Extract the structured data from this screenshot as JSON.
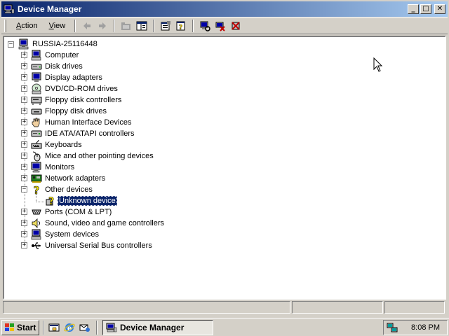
{
  "window": {
    "title": "Device Manager",
    "caption_buttons": {
      "minimize": "_",
      "maximize": "□",
      "close": "✕"
    }
  },
  "toolbar": {
    "menus": [
      {
        "label_accel": "A",
        "label_rest": "ction"
      },
      {
        "label_accel": "V",
        "label_rest": "iew"
      }
    ],
    "buttons": [
      "back-icon",
      "forward-icon",
      "up-folder-icon",
      "show-hide-tree-icon",
      "properties-icon",
      "help-icon",
      "scan-hardware-icon",
      "disable-device-icon",
      "uninstall-device-icon"
    ]
  },
  "tree": {
    "root": {
      "label": "RUSSIA-25116448",
      "icon": "computer-icon"
    },
    "items": [
      {
        "label": "Computer",
        "icon": "computer-icon",
        "expanded": false
      },
      {
        "label": "Disk drives",
        "icon": "disk-drive-icon",
        "expanded": false
      },
      {
        "label": "Display adapters",
        "icon": "display-adapter-icon",
        "expanded": false
      },
      {
        "label": "DVD/CD-ROM drives",
        "icon": "cdrom-icon",
        "expanded": false
      },
      {
        "label": "Floppy disk controllers",
        "icon": "floppy-controller-icon",
        "expanded": false
      },
      {
        "label": "Floppy disk drives",
        "icon": "floppy-drive-icon",
        "expanded": false
      },
      {
        "label": "Human Interface Devices",
        "icon": "hid-icon",
        "expanded": false
      },
      {
        "label": "IDE ATA/ATAPI controllers",
        "icon": "ide-controller-icon",
        "expanded": false
      },
      {
        "label": "Keyboards",
        "icon": "keyboard-icon",
        "expanded": false
      },
      {
        "label": "Mice and other pointing devices",
        "icon": "mouse-icon",
        "expanded": false
      },
      {
        "label": "Monitors",
        "icon": "monitor-icon",
        "expanded": false
      },
      {
        "label": "Network adapters",
        "icon": "network-adapter-icon",
        "expanded": false
      },
      {
        "label": "Other devices",
        "icon": "question-mark-icon",
        "expanded": true,
        "children": [
          {
            "label": "Unknown device",
            "icon": "unknown-device-icon",
            "selected": true
          }
        ]
      },
      {
        "label": "Ports (COM & LPT)",
        "icon": "port-icon",
        "expanded": false
      },
      {
        "label": "Sound, video and game controllers",
        "icon": "speaker-icon",
        "expanded": false
      },
      {
        "label": "System devices",
        "icon": "system-device-icon",
        "expanded": false
      },
      {
        "label": "Universal Serial Bus controllers",
        "icon": "usb-icon",
        "expanded": false
      }
    ]
  },
  "taskbar": {
    "start_label": "Start",
    "quick_launch": [
      "show-desktop-icon",
      "internet-explorer-icon",
      "outlook-express-icon"
    ],
    "tasks": [
      {
        "label": "Device Manager",
        "icon": "device-manager-icon",
        "active": true
      }
    ],
    "tray_icons": [
      "network-tray-icon"
    ],
    "clock": "8:08 PM"
  },
  "colors": {
    "titlebar_start": "#0a246a",
    "titlebar_end": "#a6caf0",
    "selection": "#0a246a",
    "face": "#d4d0c8"
  }
}
